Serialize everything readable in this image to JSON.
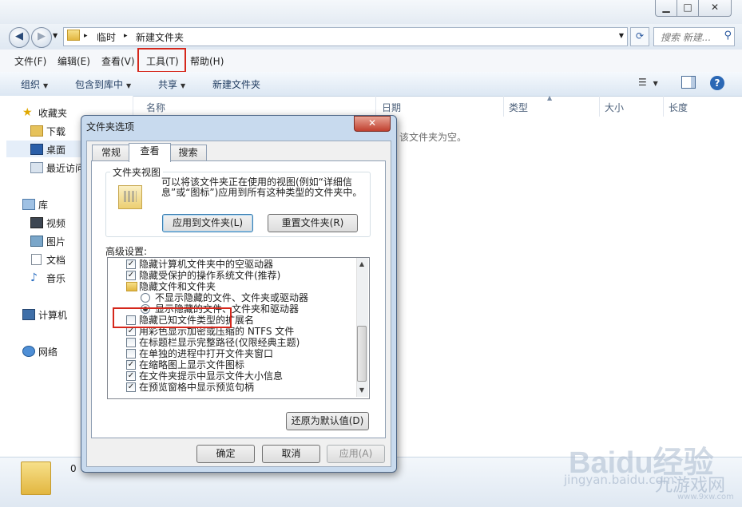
{
  "window": {
    "controls": {
      "minimize": "▁",
      "maximize": "□",
      "close": "✕"
    }
  },
  "address": {
    "back": "◀",
    "forward": "▶",
    "breadcrumb_sep": "▸",
    "path": [
      "临时",
      "新建文件夹"
    ],
    "dropdown": "▼",
    "refresh": "⟳",
    "search_placeholder": "搜索 新建...",
    "search_icon": "⚲"
  },
  "menubar": [
    "文件(F)",
    "编辑(E)",
    "查看(V)",
    "工具(T)",
    "帮助(H)"
  ],
  "toolbar": {
    "organize": "组织",
    "include": "包含到库中",
    "share": "共享",
    "newfolder": "新建文件夹",
    "help": "?"
  },
  "nav": {
    "favorites": "收藏夹",
    "downloads": "下载",
    "desktop": "桌面",
    "recent": "最近访问",
    "libraries": "库",
    "videos": "视频",
    "pictures": "图片",
    "documents": "文档",
    "music": "音乐",
    "computer": "计算机",
    "network": "网络"
  },
  "columns": [
    "名称",
    "日期",
    "类型",
    "大小",
    "长度"
  ],
  "empty_message": "该文件夹为空。",
  "details": {
    "count": "0"
  },
  "watermark": {
    "logo": "Baidu经验",
    "url": "jingyan.baidu.com",
    "brand": "九游戏网",
    "site": "www.9xw.com"
  },
  "dialog": {
    "title": "文件夹选项",
    "close": "✕",
    "tabs": [
      "常规",
      "查看",
      "搜索"
    ],
    "folder_views": {
      "label": "文件夹视图",
      "description": "可以将该文件夹正在使用的视图(例如“详细信息”或“图标”)应用到所有这种类型的文件夹中。",
      "apply_button": "应用到文件夹(L)",
      "reset_button": "重置文件夹(R)"
    },
    "advanced_label": "高级设置:",
    "settings": [
      {
        "type": "checkbox",
        "checked": true,
        "label": "隐藏计算机文件夹中的空驱动器"
      },
      {
        "type": "checkbox",
        "checked": true,
        "label": "隐藏受保护的操作系统文件(推荐)"
      },
      {
        "type": "folder",
        "label": "隐藏文件和文件夹"
      },
      {
        "type": "radio",
        "checked": false,
        "label": "不显示隐藏的文件、文件夹或驱动器"
      },
      {
        "type": "radio",
        "checked": true,
        "label": "显示隐藏的文件、文件夹和驱动器"
      },
      {
        "type": "checkbox",
        "checked": false,
        "label": "隐藏已知文件类型的扩展名"
      },
      {
        "type": "checkbox",
        "checked": true,
        "label": "用彩色显示加密或压缩的 NTFS 文件"
      },
      {
        "type": "checkbox",
        "checked": false,
        "label": "在标题栏显示完整路径(仅限经典主题)"
      },
      {
        "type": "checkbox",
        "checked": false,
        "label": "在单独的进程中打开文件夹窗口"
      },
      {
        "type": "checkbox",
        "checked": true,
        "label": "在缩略图上显示文件图标"
      },
      {
        "type": "checkbox",
        "checked": true,
        "label": "在文件夹提示中显示文件大小信息"
      },
      {
        "type": "checkbox",
        "checked": true,
        "label": "在预览窗格中显示预览句柄"
      }
    ],
    "restore_button": "还原为默认值(D)",
    "ok": "确定",
    "cancel": "取消",
    "apply": "应用(A)"
  }
}
